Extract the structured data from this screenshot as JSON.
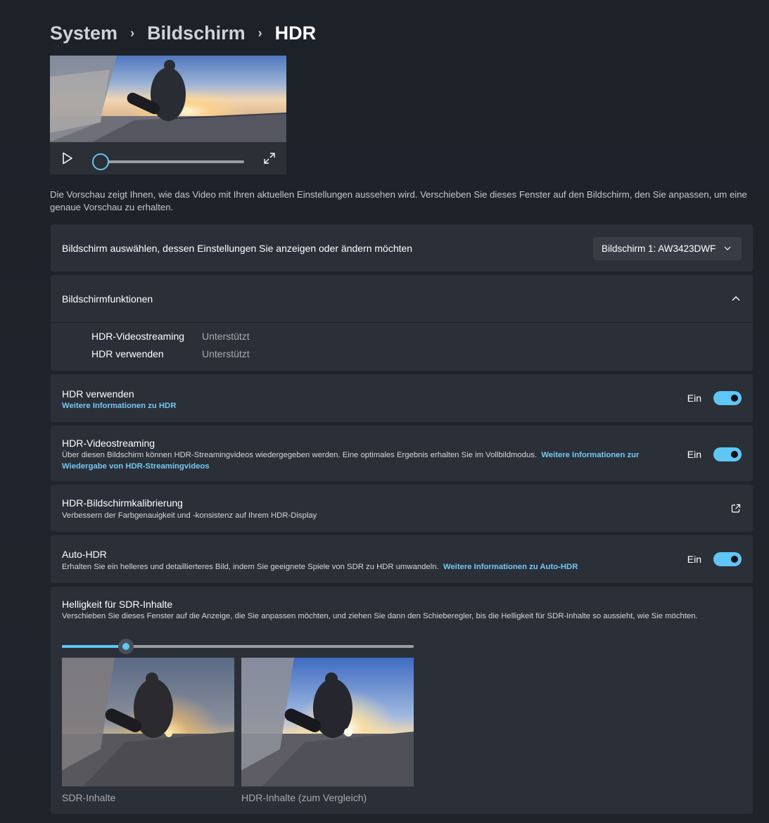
{
  "breadcrumb": {
    "items": [
      "System",
      "Bildschirm",
      "HDR"
    ],
    "separator": "›"
  },
  "video_preview": {
    "play_icon": "play-icon",
    "fullscreen_icon": "expand-icon",
    "progress": 0
  },
  "description": "Die Vorschau zeigt Ihnen, wie das Video mit Ihren aktuellen Einstellungen aussehen wird. Verschieben Sie dieses Fenster auf den Bildschirm, den Sie anpassen, um eine genaue Vorschau zu erhalten.",
  "display_select": {
    "label": "Bildschirm auswählen, dessen Einstellungen Sie anzeigen oder ändern möchten",
    "value": "Bildschirm 1: AW3423DWF"
  },
  "capabilities": {
    "title": "Bildschirmfunktionen",
    "rows": [
      {
        "name": "HDR-Videostreaming",
        "value": "Unterstützt"
      },
      {
        "name": "HDR verwenden",
        "value": "Unterstützt"
      }
    ]
  },
  "use_hdr": {
    "title": "HDR verwenden",
    "link": "Weitere Informationen zu HDR",
    "state": "Ein"
  },
  "hdr_streaming": {
    "title": "HDR-Videostreaming",
    "desc": "Über diesen Bildschirm können HDR-Streamingvideos wiedergegeben werden. Eine optimales Ergebnis erhalten Sie im Vollbildmodus.",
    "link": "Weitere Informationen zur Wiedergabe von HDR-Streamingvideos",
    "state": "Ein"
  },
  "calibration": {
    "title": "HDR-Bildschirmkalibrierung",
    "desc": "Verbessern der Farbgenauigkeit und -konsistenz auf Ihrem HDR-Display"
  },
  "auto_hdr": {
    "title": "Auto-HDR",
    "desc": "Erhalten Sie ein helleres und detaillierteres Bild, indem Sie geeignete Spiele von SDR zu HDR umwandeln.",
    "link": "Weitere Informationen zu Auto-HDR",
    "state": "Ein"
  },
  "sdr_brightness": {
    "title": "Helligkeit für SDR-Inhalte",
    "desc": "Verschieben Sie dieses Fenster auf die Anzeige, die Sie anpassen möchten, und ziehen Sie dann den Schieberegler, bis die Helligkeit für SDR-Inhalte so aussieht, wie Sie möchten.",
    "slider_value": 0.18,
    "sdr_caption": "SDR-Inhalte",
    "hdr_caption": "HDR-Inhalte (zum Vergleich)"
  },
  "colors": {
    "accent": "#5fc6f5",
    "link": "#75c8f5",
    "card": "#2b3038",
    "background": "#1f242b"
  }
}
